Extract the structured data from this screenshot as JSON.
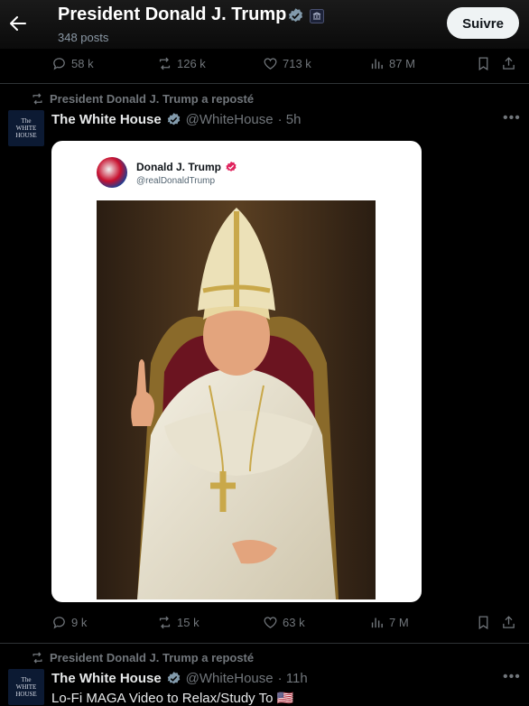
{
  "header": {
    "title": "President Donald J. Trump",
    "posts": "348 posts",
    "follow_label": "Suivre"
  },
  "tweet0": {
    "replies": "58 k",
    "reposts": "126 k",
    "likes": "713 k",
    "views": "87 M"
  },
  "tweet1": {
    "repost_label": "President Donald J. Trump a reposté",
    "name": "The White House",
    "handle": "@WhiteHouse",
    "time": "· 5h",
    "avatar_line1": "The",
    "avatar_line2": "WHITE",
    "avatar_line3": "HOUSE",
    "card": {
      "name": "Donald J. Trump",
      "handle": "@realDonaldTrump"
    },
    "replies": "9 k",
    "reposts": "15 k",
    "likes": "63 k",
    "views": "7 M"
  },
  "tweet2": {
    "repost_label": "President Donald J. Trump a reposté",
    "name": "The White House",
    "handle": "@WhiteHouse",
    "time": "· 11h",
    "avatar_line1": "The",
    "avatar_line2": "WHITE",
    "avatar_line3": "HOUSE",
    "text": "Lo-Fi MAGA Video to Relax/Study To 🇺🇸"
  },
  "colors": {
    "verified": "#829aab",
    "card_verified": "#e0245e",
    "muted": "#71767b"
  }
}
